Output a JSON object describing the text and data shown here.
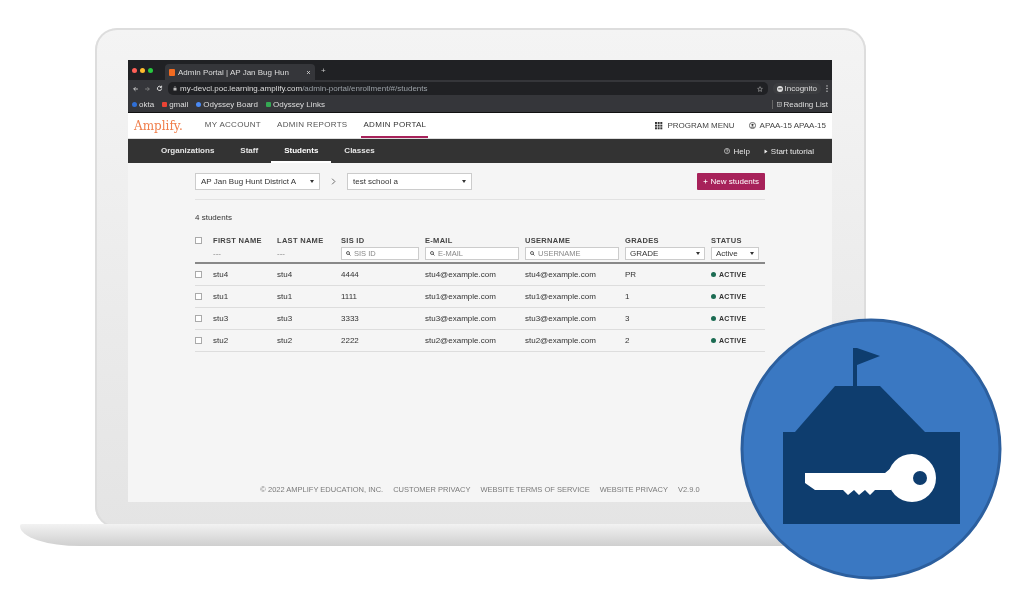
{
  "browser": {
    "tab_title": "Admin Portal | AP Jan Bug Hun",
    "new_tab": "+",
    "url_host": "my-devcl.poc.learning.amplify.com",
    "url_path": "/admin-portal/enrollment/#/students",
    "profile": "Incognito",
    "bookmarks": [
      "okta",
      "gmail",
      "Odyssey Board",
      "Odyssey Links"
    ],
    "reading_list": "Reading List"
  },
  "header": {
    "logo": "Amplify.",
    "nav": [
      {
        "label": "MY ACCOUNT",
        "selected": false
      },
      {
        "label": "ADMIN REPORTS",
        "selected": false
      },
      {
        "label": "ADMIN PORTAL",
        "selected": true
      }
    ],
    "program_menu": "PROGRAM MENU",
    "user": "APAA-15 APAA-15"
  },
  "subnav": {
    "items": [
      {
        "label": "Organizations",
        "selected": false
      },
      {
        "label": "Staff",
        "selected": false
      },
      {
        "label": "Students",
        "selected": true
      },
      {
        "label": "Classes",
        "selected": false
      }
    ],
    "help": "Help",
    "tutorial": "Start tutorial"
  },
  "toolbar": {
    "district": "AP Jan Bug Hunt District A",
    "school": "test school a",
    "new_button": "New students"
  },
  "count": "4 students",
  "table": {
    "select_all_checked": false,
    "columns": [
      "FIRST NAME",
      "LAST NAME",
      "SIS ID",
      "E-MAIL",
      "USERNAME",
      "GRADES",
      "STATUS"
    ],
    "filters": [
      {
        "kind": "text",
        "value": "---"
      },
      {
        "kind": "text",
        "value": "---"
      },
      {
        "kind": "search",
        "placeholder": "SIS ID"
      },
      {
        "kind": "search",
        "placeholder": "E-MAIL"
      },
      {
        "kind": "search",
        "placeholder": "USERNAME"
      },
      {
        "kind": "select",
        "value": "GRADE"
      },
      {
        "kind": "select",
        "value": "Active"
      }
    ],
    "rows": [
      {
        "cells": [
          "stu4",
          "stu4",
          "4444",
          "stu4@example.com",
          "stu4@example.com",
          "PR"
        ],
        "status": "ACTIVE",
        "color": "#1b6b52",
        "checked": false
      },
      {
        "cells": [
          "stu1",
          "stu1",
          "1111",
          "stu1@example.com",
          "stu1@example.com",
          "1"
        ],
        "status": "ACTIVE",
        "color": "#1b6b52",
        "checked": false
      },
      {
        "cells": [
          "stu3",
          "stu3",
          "3333",
          "stu3@example.com",
          "stu3@example.com",
          "3"
        ],
        "status": "ACTIVE",
        "color": "#1b6b52",
        "checked": false
      },
      {
        "cells": [
          "stu2",
          "stu2",
          "2222",
          "stu2@example.com",
          "stu2@example.com",
          "2"
        ],
        "status": "ACTIVE",
        "color": "#1b6b52",
        "checked": false
      }
    ]
  },
  "footer": [
    "© 2022 AMPLIFY EDUCATION, INC.",
    "CUSTOMER PRIVACY",
    "WEBSITE TERMS OF SERVICE",
    "WEBSITE PRIVACY",
    "V2.9.0"
  ]
}
